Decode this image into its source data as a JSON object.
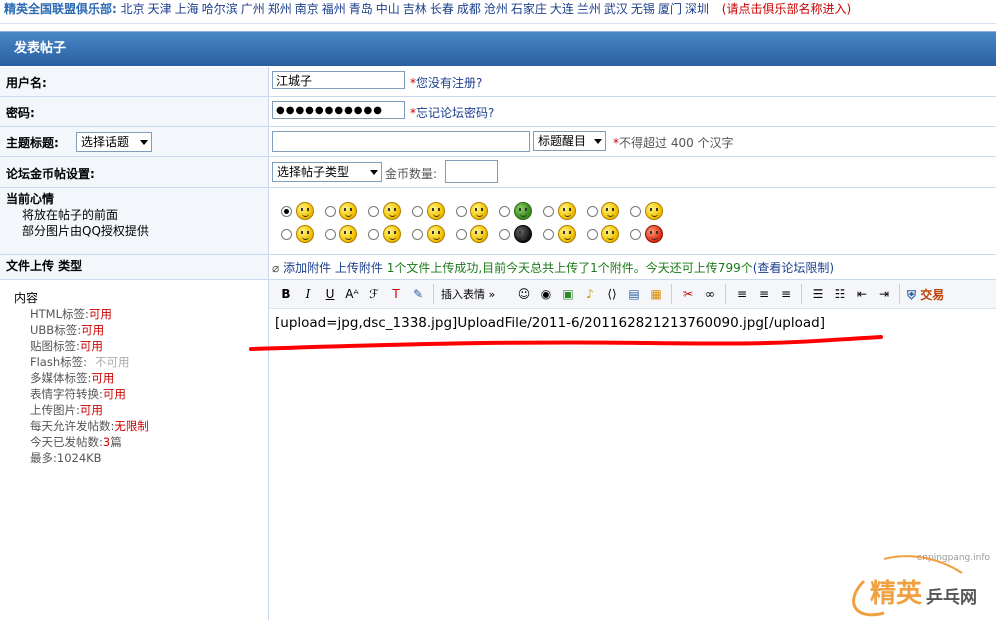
{
  "topbar": {
    "lead": "精英全国联盟俱乐部:",
    "cities": [
      "北京",
      "天津",
      "上海",
      "哈尔滨",
      "广州",
      "郑州",
      "南京",
      "福州",
      "青岛",
      "中山",
      "吉林",
      "长春",
      "成都",
      "沧州",
      "石家庄",
      "大连",
      "兰州",
      "武汉",
      "无锡",
      "厦门",
      "深圳"
    ],
    "enter": "(请点击俱乐部名称进入)"
  },
  "form": {
    "title": "发表帖子",
    "username": {
      "label": "用户名:",
      "value": "江城子",
      "note": "您没有注册?"
    },
    "password": {
      "label": "密码:",
      "value": "●●●●●●●●●●●",
      "note": "忘记论坛密码?"
    },
    "subject": {
      "label": "主题标题:",
      "topic_select": "选择话题",
      "value": "",
      "color_select": "标题醒目",
      "note": "不得超过 400 个汉字"
    },
    "coin": {
      "label": "论坛金币帖设置:",
      "type_select": "选择帖子类型",
      "amount_label": "金币数量:",
      "amount": ""
    },
    "mood": {
      "label": "当前心情",
      "desc1": "将放在帖子的前面",
      "desc2": "部分图片由QQ授权提供"
    },
    "upload": {
      "label": "文件上传 类型",
      "link": "添加附件 上传附件",
      "status": "1个文件上传成功,目前今天总共上传了1个附件。今天还可上传799个",
      "limit_link": "(查看论坛限制)"
    },
    "content": {
      "label": "内容",
      "rules": [
        {
          "name": "HTML标签:",
          "value": "可用"
        },
        {
          "name": "UBB标签:",
          "value": "可用"
        },
        {
          "name": "贴图标签:",
          "value": "可用"
        },
        {
          "name": "Flash标签:",
          "value": "不可用"
        },
        {
          "name": "多媒体标签:",
          "value": "可用"
        },
        {
          "name": "表情字符转换:",
          "value": "可用"
        },
        {
          "name": "上传图片:",
          "value": "可用"
        },
        {
          "name": "每天允许发帖数:",
          "value": "无限制"
        },
        {
          "name": "今天已发帖数:",
          "value": "3",
          "suffix": "篇"
        },
        {
          "name": "最多:",
          "value": "1024KB"
        }
      ],
      "editor_text": "[upload=jpg,dsc_1338.jpg]UploadFile/2011-6/201162821213760090.jpg[/upload]",
      "toolbar": {
        "insert_emoticon": "插入表情 »",
        "trade": "交易"
      }
    }
  },
  "watermark": {
    "url": "enpingpang.info",
    "brand_a": "精英",
    "brand_b": "乒乓网"
  },
  "colors": {
    "header": "#2a5fa1",
    "required": "#cc0000",
    "annotation": "#ff0000"
  }
}
